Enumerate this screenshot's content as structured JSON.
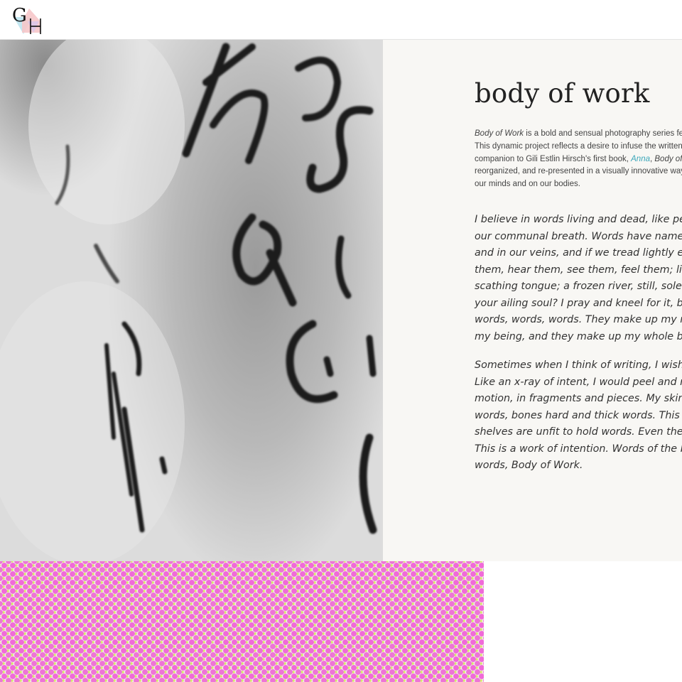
{
  "header": {
    "logo_text": "GH"
  },
  "photo": {
    "handwriting_fragments": [
      "Th",
      "a sn",
      "s",
      "a"
    ]
  },
  "article": {
    "title": "body of work",
    "intro": {
      "line1_em": "Body of Work",
      "line1_rest": " is a bold and sensual photography series fea",
      "line2": "This dynamic project reflects a desire to infuse the written",
      "line3_pre": "companion to Gili Estlin Hirsch's first book, ",
      "line3_link": "Anna",
      "line3_mid": ", ",
      "line3_em": "Body of W",
      "line4": "reorganized, and re-presented in a visually innovative way",
      "line5": "our minds and on our bodies."
    },
    "quote1": [
      "I believe in words living and dead, like people",
      "our communal breath. Words have name an",
      "and in our veins, and if we tread lightly enou",
      "them, hear them, see them, feel them; like a",
      "scathing tongue; a frozen river, still, solemn.",
      "your ailing soul? I pray and kneel for it, bite a",
      "words, words, words. They make up my mind",
      "my being, and they make up my whole body."
    ],
    "quote2": [
      "Sometimes when I think of writing, I wish I co",
      "Like an x-ray of intent, I would peel and reve",
      "motion, in fragments and pieces. My skin firs",
      "words, bones hard and thick words. This is m",
      "shelves are unfit to hold words. Even the ma",
      "This is a work of intention. Words of the body",
      "words, Body of Work."
    ]
  },
  "colors": {
    "accent_link": "#3aa6b9",
    "panel_bg": "#f8f7f4",
    "dot_pink": "#f06ad8",
    "dot_yellow": "#d6e96a"
  }
}
